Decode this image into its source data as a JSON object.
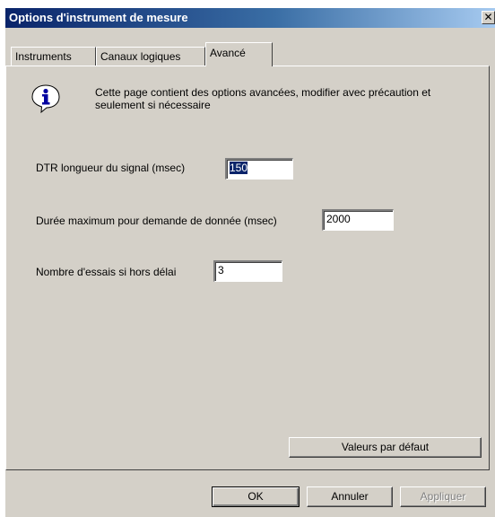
{
  "window": {
    "title": "Options d'instrument de mesure",
    "close_glyph": "✕"
  },
  "tabs": [
    {
      "label": "Instruments",
      "active": false
    },
    {
      "label": "Canaux logiques",
      "active": false
    },
    {
      "label": "Avancé",
      "active": true
    }
  ],
  "info": {
    "icon": "info-icon",
    "text": "Cette page contient des options avancées, modifier avec précaution et seulement si nécessaire"
  },
  "fields": {
    "dtr": {
      "label": "DTR longueur du signal (msec)",
      "value": "150"
    },
    "max_duration": {
      "label": "Durée maximum pour demande de donnée (msec)",
      "value": "2000"
    },
    "retries": {
      "label": "Nombre d'essais si hors délai",
      "value": "3"
    }
  },
  "buttons": {
    "defaults": "Valeurs par défaut",
    "ok": "OK",
    "cancel": "Annuler",
    "apply": "Appliquer"
  },
  "colors": {
    "titlebar_start": "#0a246a",
    "titlebar_end": "#a6caf0",
    "face": "#d4d0c8",
    "selection": "#0a246a"
  }
}
